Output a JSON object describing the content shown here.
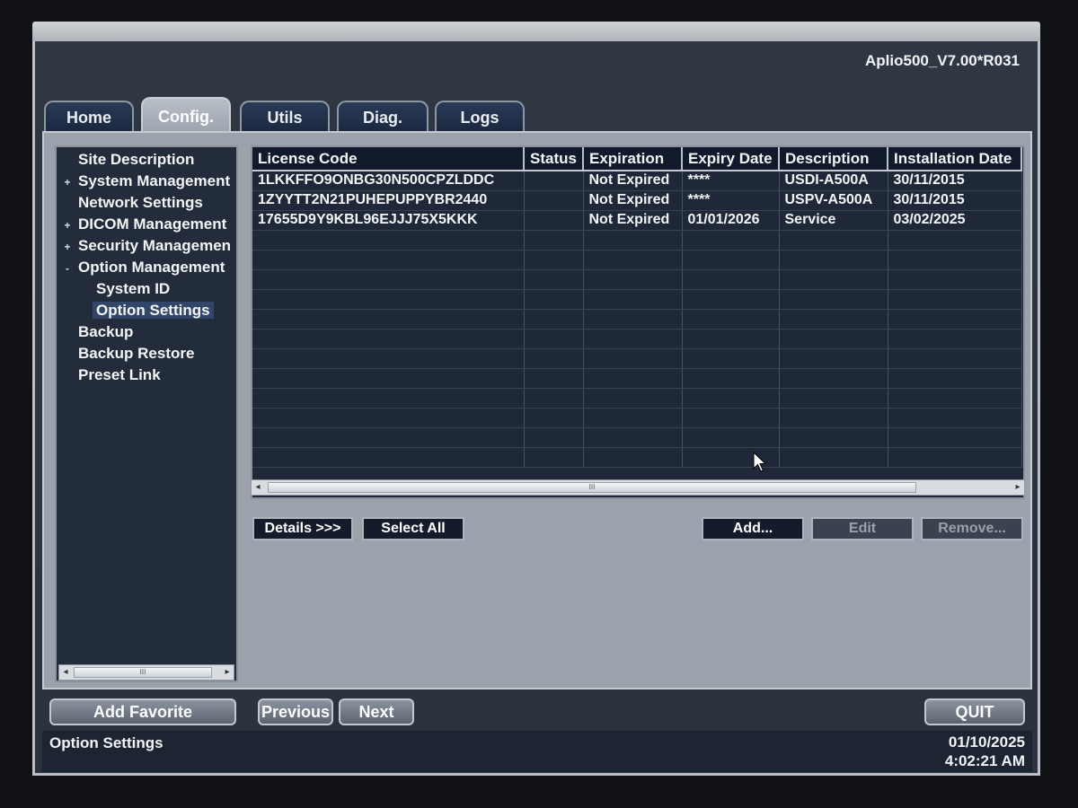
{
  "header": {
    "version": "Aplio500_V7.00*R031"
  },
  "tabs": [
    {
      "label": "Home"
    },
    {
      "label": "Config."
    },
    {
      "label": "Utils"
    },
    {
      "label": "Diag."
    },
    {
      "label": "Logs"
    }
  ],
  "active_tab": "Config.",
  "tree": {
    "items": [
      {
        "label": "Site Description",
        "expander": ""
      },
      {
        "label": "System Management",
        "expander": "+"
      },
      {
        "label": "Network Settings",
        "expander": ""
      },
      {
        "label": "DICOM Management",
        "expander": "+"
      },
      {
        "label": "Security Managemen",
        "expander": "+"
      },
      {
        "label": "Option Management",
        "expander": "-"
      },
      {
        "label": "System ID"
      },
      {
        "label": "Option Settings"
      },
      {
        "label": "Backup",
        "expander": ""
      },
      {
        "label": "Backup Restore",
        "expander": ""
      },
      {
        "label": "Preset Link",
        "expander": ""
      }
    ],
    "selected": "Option Settings",
    "scroll_thumb": "III"
  },
  "table": {
    "columns": [
      "License Code",
      "Status",
      "Expiration",
      "Expiry Date",
      "Description",
      "Installation Date"
    ],
    "rows": [
      [
        "1LKKFFO9ONBG30N500CPZLDDC",
        "",
        "Not Expired",
        "****",
        "USDI-A500A",
        "30/11/2015"
      ],
      [
        "1ZYYTT2N21PUHEPUPPYBR2440",
        "",
        "Not Expired",
        "****",
        "USPV-A500A",
        "30/11/2015"
      ],
      [
        "17655D9Y9KBL96EJJJ75X5KKK",
        "",
        "Not Expired",
        "01/01/2026",
        "Service",
        "03/02/2025"
      ]
    ],
    "scroll_thumb": "III"
  },
  "buttons": {
    "details": "Details >>>",
    "select_all": "Select All",
    "add": "Add...",
    "edit": "Edit",
    "remove": "Remove..."
  },
  "bottom": {
    "add_favorite": "Add Favorite",
    "previous": "Previous",
    "next": "Next",
    "quit": "QUIT"
  },
  "status": {
    "page": "Option Settings",
    "date": "01/10/2025",
    "time": "4:02:21 AM"
  }
}
